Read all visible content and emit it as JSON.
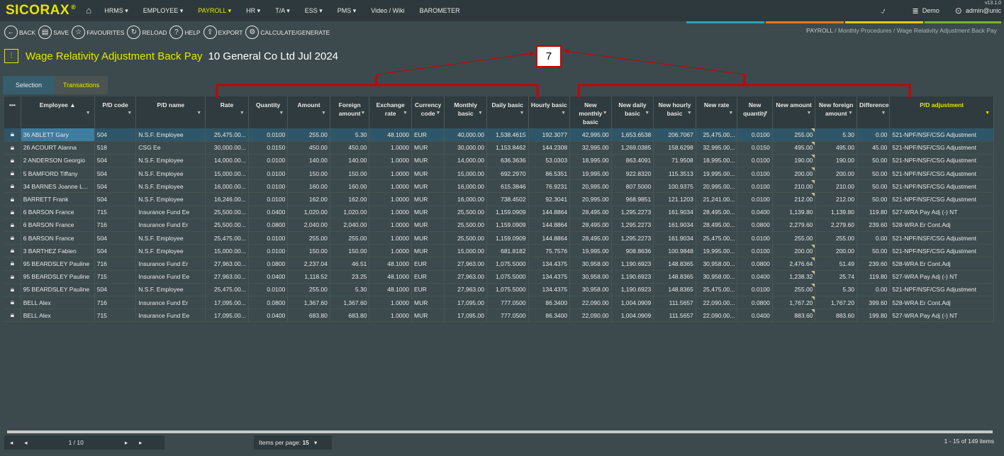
{
  "app": {
    "logo": "SICORAX",
    "reg": "®",
    "version": "v13.1.0"
  },
  "menu": [
    "HRMS ▾",
    "EMPLOYEE ▾",
    "PAYROLL ▾",
    "HR ▾",
    "T/A ▾",
    "ESS ▾",
    "PMS ▾",
    "Video / Wiki",
    "BAROMETER"
  ],
  "user": {
    "db": "Demo",
    "name": "admin@unic"
  },
  "toolbar": {
    "back": "BACK",
    "save": "SAVE",
    "fav": "FAVOURITES",
    "reload": "RELOAD",
    "help": "HELP",
    "export": "EXPORT",
    "calc": "CALCULATE/GENERATE"
  },
  "breadcrumb": {
    "a": "PAYROLL",
    "b": "Monthly Procedures",
    "c": "Wage Relativity Adjustment Back Pay"
  },
  "title": {
    "main": "Wage Relativity Adjustment Back Pay",
    "sub": "10 General Co Ltd Jul 2024"
  },
  "tabs": {
    "selection": "Selection",
    "transactions": "Transactions"
  },
  "callout": "7",
  "columns": [
    "•••",
    "Employee ▲",
    "P/D code",
    "P/D name",
    "Rate",
    "Quantity",
    "Amount",
    "Foreign amount",
    "Exchange rate",
    "Currency code",
    "Monthly basic",
    "Daily basic",
    "Hourly basic",
    "New monthly basic",
    "New daily basic",
    "New hourly basic",
    "New rate",
    "New quantity",
    "New amount",
    "New foreign amount",
    "Difference",
    "P/D adjustment"
  ],
  "rows": [
    [
      "36 ABLETT Gary",
      "504",
      "N.S.F. Employee",
      "25,475.00...",
      "0.0100",
      "255.00",
      "5.30",
      "48.1000",
      "EUR",
      "40,000.00",
      "1,538.4615",
      "192.3077",
      "42,995.00",
      "1,653.6538",
      "206.7067",
      "25,475.00...",
      "0.0100",
      "255.00",
      "5.30",
      "0.00",
      "521-NPF/NSF/CSG Adjustment"
    ],
    [
      "26 ACOURT Alanna",
      "518",
      "CSG Ee",
      "30,000.00...",
      "0.0150",
      "450.00",
      "450.00",
      "1.0000",
      "MUR",
      "30,000.00",
      "1,153.8462",
      "144.2308",
      "32,995.00",
      "1,269.0385",
      "158.6298",
      "32,995.00...",
      "0.0150",
      "495.00",
      "495.00",
      "45.00",
      "521-NPF/NSF/CSG Adjustment"
    ],
    [
      "2 ANDERSON Georgio",
      "504",
      "N.S.F. Employee",
      "14,000.00...",
      "0.0100",
      "140.00",
      "140.00",
      "1.0000",
      "MUR",
      "14,000.00",
      "636.3636",
      "53.0303",
      "18,995.00",
      "863.4091",
      "71.9508",
      "18,995.00...",
      "0.0100",
      "190.00",
      "190.00",
      "50.00",
      "521-NPF/NSF/CSG Adjustment"
    ],
    [
      "5 BAMFORD Tiffany",
      "504",
      "N.S.F. Employee",
      "15,000.00...",
      "0.0100",
      "150.00",
      "150.00",
      "1.0000",
      "MUR",
      "15,000.00",
      "692.2970",
      "86.5351",
      "19,995.00",
      "922.8320",
      "115.3513",
      "19,995.00...",
      "0.0100",
      "200.00",
      "200.00",
      "50.00",
      "521-NPF/NSF/CSG Adjustment"
    ],
    [
      "34 BARNES Joanne L...",
      "504",
      "N.S.F. Employee",
      "16,000.00...",
      "0.0100",
      "160.00",
      "160.00",
      "1.0000",
      "MUR",
      "16,000.00",
      "615.3846",
      "76.9231",
      "20,995.00",
      "807.5000",
      "100.9375",
      "20,995.00...",
      "0.0100",
      "210.00",
      "210.00",
      "50.00",
      "521-NPF/NSF/CSG Adjustment"
    ],
    [
      "BARRETT Frank",
      "504",
      "N.S.F. Employee",
      "16,246.00...",
      "0.0100",
      "162.00",
      "162.00",
      "1.0000",
      "MUR",
      "16,000.00",
      "738.4502",
      "92.3041",
      "20,995.00",
      "968.9851",
      "121.1203",
      "21,241.00...",
      "0.0100",
      "212.00",
      "212.00",
      "50.00",
      "521-NPF/NSF/CSG Adjustment"
    ],
    [
      "6 BARSON France",
      "715",
      "Insurance Fund Ee",
      "25,500.00...",
      "0.0400",
      "1,020.00",
      "1,020.00",
      "1.0000",
      "MUR",
      "25,500.00",
      "1,159.0909",
      "144.8864",
      "28,495.00",
      "1,295.2273",
      "161.9034",
      "28,495.00...",
      "0.0400",
      "1,139.80",
      "1,139.80",
      "119.80",
      "527-WRA Pay Adj (-) NT"
    ],
    [
      "6 BARSON France",
      "716",
      "Insurance Fund Er",
      "25,500.00...",
      "0.0800",
      "2,040.00",
      "2,040.00",
      "1.0000",
      "MUR",
      "25,500.00",
      "1,159.0909",
      "144.8864",
      "28,495.00",
      "1,295.2273",
      "161.9034",
      "28,495.00...",
      "0.0800",
      "2,279.60",
      "2,279.60",
      "239.60",
      "528-WRA Er Cont.Adj"
    ],
    [
      "6 BARSON France",
      "504",
      "N.S.F. Employee",
      "25,475.00...",
      "0.0100",
      "255.00",
      "255.00",
      "1.0000",
      "MUR",
      "25,500.00",
      "1,159.0909",
      "144.8864",
      "28,495.00",
      "1,295.2273",
      "161.9034",
      "25,475.00...",
      "0.0100",
      "255.00",
      "255.00",
      "0.00",
      "521-NPF/NSF/CSG Adjustment"
    ],
    [
      "3 BARTHEZ Fabien",
      "504",
      "N.S.F. Employee",
      "15,000.00...",
      "0.0100",
      "150.00",
      "150.00",
      "1.0000",
      "MUR",
      "15,000.00",
      "681.8182",
      "75.7576",
      "19,995.00",
      "908.8636",
      "100.9848",
      "19,995.00...",
      "0.0100",
      "200.00",
      "200.00",
      "50.00",
      "521-NPF/NSF/CSG Adjustment"
    ],
    [
      "95 BEARDSLEY Pauline",
      "716",
      "Insurance Fund Er",
      "27,963.00...",
      "0.0800",
      "2,237.04",
      "46.51",
      "48.1000",
      "EUR",
      "27,963.00",
      "1,075.5000",
      "134.4375",
      "30,958.00",
      "1,190.6923",
      "148.8365",
      "30,958.00...",
      "0.0800",
      "2,476.64",
      "51.49",
      "239.60",
      "528-WRA Er Cont.Adj"
    ],
    [
      "95 BEARDSLEY Pauline",
      "715",
      "Insurance Fund Ee",
      "27,963.00...",
      "0.0400",
      "1,118.52",
      "23.25",
      "48.1000",
      "EUR",
      "27,963.00",
      "1,075.5000",
      "134.4375",
      "30,958.00",
      "1,190.6923",
      "148.8365",
      "30,958.00...",
      "0.0400",
      "1,238.32",
      "25.74",
      "119.80",
      "527-WRA Pay Adj (-) NT"
    ],
    [
      "95 BEARDSLEY Pauline",
      "504",
      "N.S.F. Employee",
      "25,475.00...",
      "0.0100",
      "255.00",
      "5.30",
      "48.1000",
      "EUR",
      "27,963.00",
      "1,075.5000",
      "134.4375",
      "30,958.00",
      "1,190.6923",
      "148.8365",
      "25,475.00...",
      "0.0100",
      "255.00",
      "5.30",
      "0.00",
      "521-NPF/NSF/CSG Adjustment"
    ],
    [
      "BELL Alex",
      "716",
      "Insurance Fund Er",
      "17,095.00...",
      "0.0800",
      "1,367.60",
      "1,367.60",
      "1.0000",
      "MUR",
      "17,095.00",
      "777.0500",
      "86.3400",
      "22,090.00",
      "1,004.0909",
      "111.5657",
      "22,090.00...",
      "0.0800",
      "1,767.20",
      "1,767.20",
      "399.60",
      "528-WRA Er Cont.Adj"
    ],
    [
      "BELL Alex",
      "715",
      "Insurance Fund Ee",
      "17,095.00...",
      "0.0400",
      "683.80",
      "683.80",
      "1.0000",
      "MUR",
      "17,095.00",
      "777.0500",
      "86.3400",
      "22,090.00",
      "1,004.0909",
      "111.5657",
      "22,090.00...",
      "0.0400",
      "883.60",
      "883.60",
      "199.80",
      "527-WRA Pay Adj (-) NT"
    ]
  ],
  "pager": {
    "page": "1 / 10",
    "ipp_label": "Items per page:",
    "ipp": "15",
    "count": "1 - 15 of 149 items"
  },
  "colors": {
    "accent": "#e6e600",
    "annotation": "#cc0000"
  }
}
